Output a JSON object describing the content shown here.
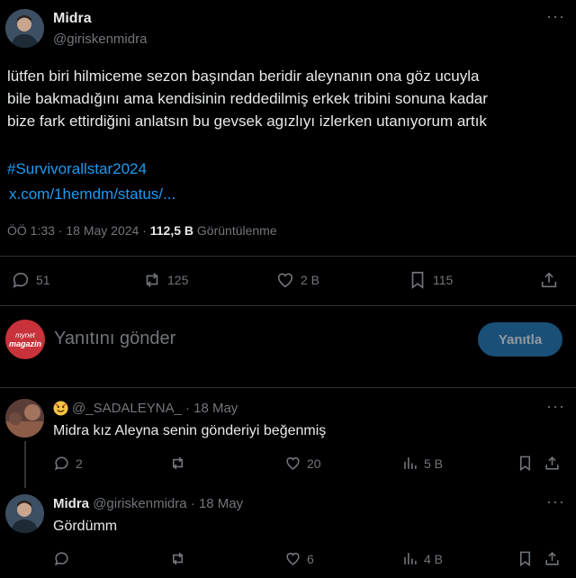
{
  "main_tweet": {
    "author_name": "Midra",
    "author_handle": "@giriskenmidra",
    "text_line1": "lütfen biri hilmiceme sezon başından beridir aleynanın ona göz ucuyla",
    "text_line2": "bile bakmadığını ama kendisinin reddedilmiş erkek tribini sonuna kadar",
    "text_line3": "bize fark ettirdiğini anlatsın bu gevsek agızlıyı izlerken utanıyorum artık",
    "hashtag": "#Survivorallstar2024",
    "link": "x.com/1hemdm/status/...",
    "time": "ÖÖ 1:33 · 18 May 2024 ·",
    "views_count": "112,5 B",
    "views_label": "Görüntülenme",
    "replies": "51",
    "reposts": "125",
    "likes": "2 B",
    "bookmarks": "115"
  },
  "composer": {
    "avatar_text_top": "mynet",
    "avatar_text_bottom": "magazin",
    "placeholder": "Yanıtını gönder",
    "reply_button": "Yanıtla"
  },
  "reply1": {
    "author_handle": "@_SADALEYNA_",
    "time": "· 18 May",
    "text": "Midra kız Aleyna senin gönderiyi beğenmiş",
    "replies": "2",
    "likes": "20",
    "views": "5 B"
  },
  "reply2": {
    "author_name": "Midra",
    "author_handle": "@giriskenmidra",
    "time": "· 18 May",
    "text": "Gördümm",
    "likes": "6",
    "views": "4 B"
  },
  "colors": {
    "background": "#000000",
    "text": "#e7e9ea",
    "muted": "#71767b",
    "accent": "#1d9bf0",
    "button_bg": "#1a4f78",
    "divider": "#2f3336"
  }
}
